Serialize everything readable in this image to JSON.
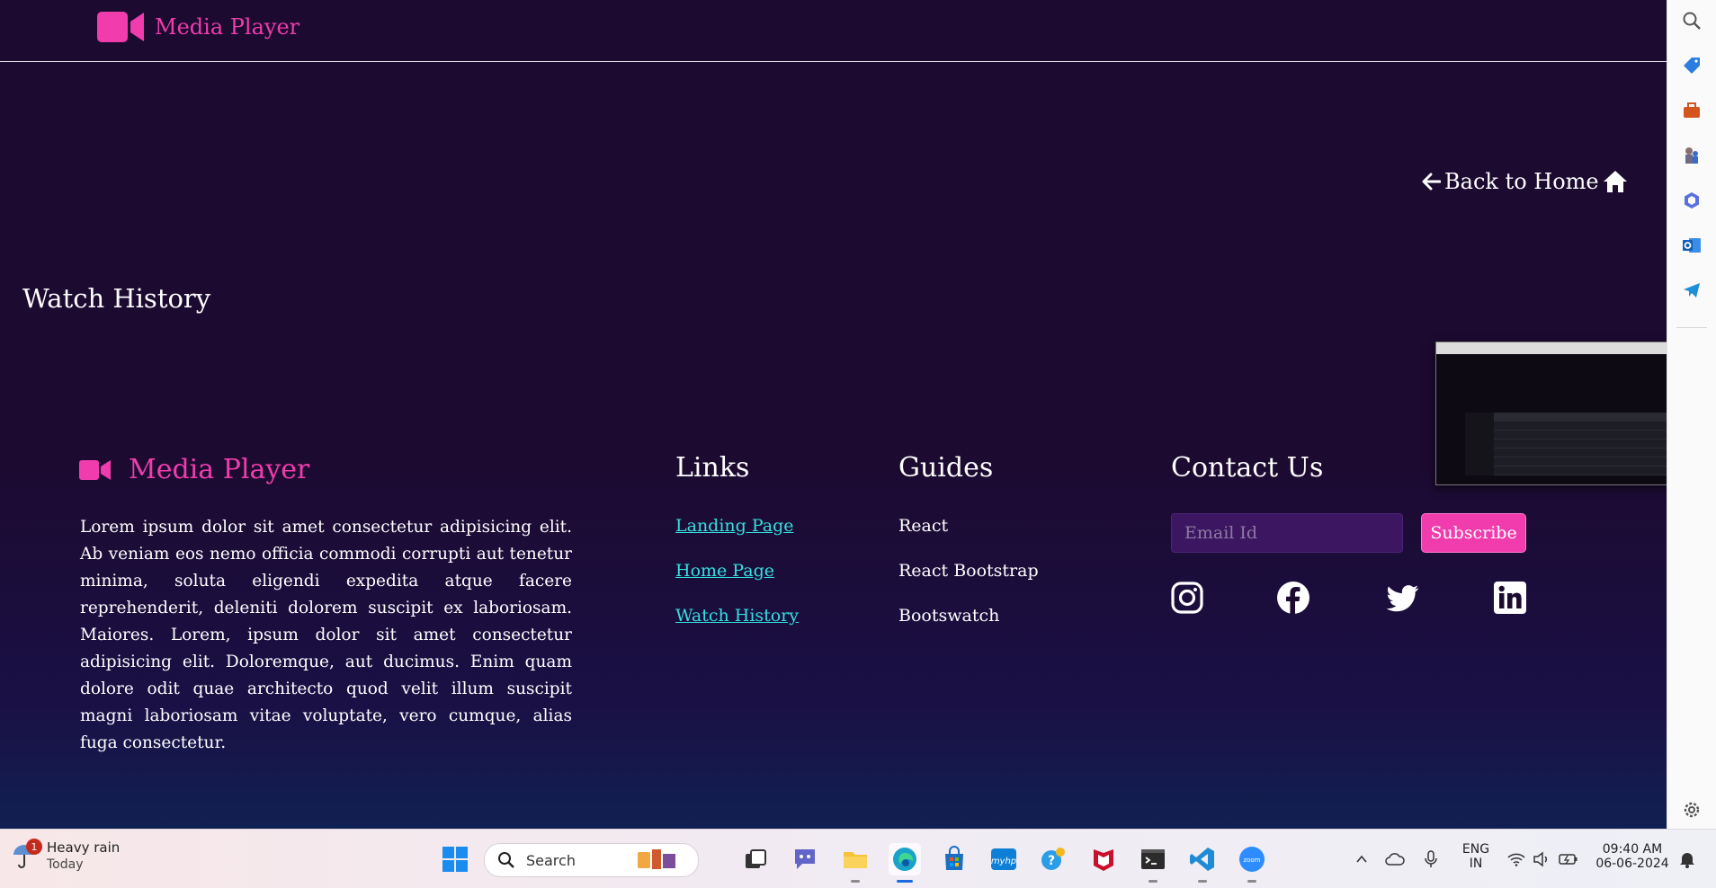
{
  "app": {
    "brand": "Media Player",
    "back_link": "Back to Home",
    "page_title": "Watch History"
  },
  "footer": {
    "brand": "Media Player",
    "description": "Lorem ipsum dolor sit amet consectetur adipisicing elit. Ab veniam eos nemo officia commodi corrupti aut tenetur minima, soluta eligendi expedita atque facere reprehenderit, deleniti dolorem suscipit ex laboriosam. Maiores. Lorem, ipsum dolor sit amet consectetur adipisicing elit. Doloremque, aut ducimus. Enim quam dolore odit quae architecto quod velit illum suscipit magni laboriosam vitae voluptate, vero cumque, alias fuga consectetur.",
    "links_title": "Links",
    "links": [
      "Landing Page",
      "Home Page",
      "Watch History"
    ],
    "guides_title": "Guides",
    "guides": [
      "React",
      "React Bootstrap",
      "Bootswatch"
    ],
    "contact_title": "Contact Us",
    "email_placeholder": "Email Id",
    "subscribe_label": "Subscribe",
    "social": [
      "instagram-icon",
      "facebook-icon",
      "twitter-icon",
      "linkedin-icon"
    ]
  },
  "colors": {
    "accent": "#f03cad",
    "link": "#35e0e0",
    "background": "#1c0a30"
  },
  "taskbar": {
    "weather_title": "Heavy rain",
    "weather_sub": "Today",
    "weather_badge": "1",
    "search_placeholder": "Search",
    "lang_1": "ENG",
    "lang_2": "IN",
    "time": "09:40 AM",
    "date": "06-06-2024"
  }
}
